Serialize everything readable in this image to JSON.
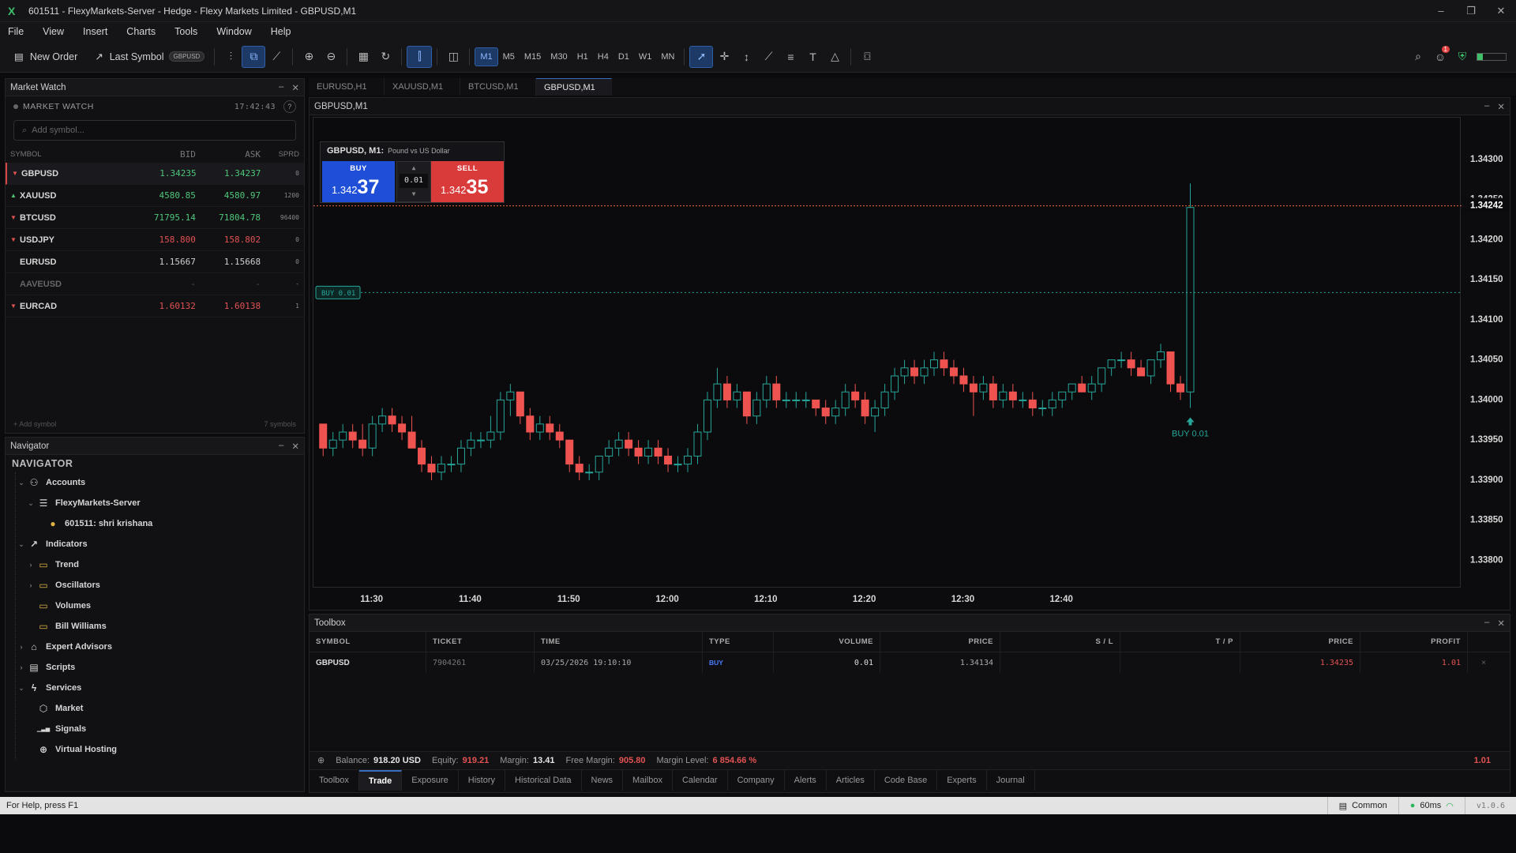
{
  "window": {
    "title": "601511 - FlexyMarkets-Server - Hedge - Flexy Markets Limited - GBPUSD,M1",
    "logo": "X",
    "min": "–",
    "restore": "❐",
    "close": "✕"
  },
  "menu": [
    "File",
    "View",
    "Insert",
    "Charts",
    "Tools",
    "Window",
    "Help"
  ],
  "toolbar": {
    "new_order": "New Order",
    "last_symbol": "Last Symbol",
    "last_symbol_badge": "GBPUSD",
    "timeframes": [
      "M1",
      "M5",
      "M15",
      "M30",
      "H1",
      "H4",
      "D1",
      "W1",
      "MN"
    ],
    "active_tf": "M1",
    "notif_count": "1"
  },
  "market_watch": {
    "title": "Market Watch",
    "subtitle": "MARKET WATCH",
    "time": "17:42:43",
    "help": "?",
    "search_placeholder": "Add symbol...",
    "columns": [
      "SYMBOL",
      "BID",
      "ASK",
      "SPRD"
    ],
    "rows": [
      {
        "symbol": "GBPUSD",
        "dir": "down",
        "bid": "1.34235",
        "ask": "1.34237",
        "spread": "0",
        "color": "up"
      },
      {
        "symbol": "XAUUSD",
        "dir": "up",
        "bid": "4580.85",
        "ask": "4580.97",
        "spread": "1200",
        "color": "up"
      },
      {
        "symbol": "BTCUSD",
        "dir": "down",
        "bid": "71795.14",
        "ask": "71804.78",
        "spread": "96400",
        "color": "up"
      },
      {
        "symbol": "USDJPY",
        "dir": "down",
        "bid": "158.800",
        "ask": "158.802",
        "spread": "0",
        "color": "dn"
      },
      {
        "symbol": "EURUSD",
        "dir": "none",
        "bid": "1.15667",
        "ask": "1.15668",
        "spread": "0",
        "color": "nt"
      },
      {
        "symbol": "AAVEUSD",
        "dir": "none",
        "bid": "-",
        "ask": "-",
        "spread": "-",
        "color": "dim"
      },
      {
        "symbol": "EURCAD",
        "dir": "down",
        "bid": "1.60132",
        "ask": "1.60138",
        "spread": "1",
        "color": "dn"
      }
    ],
    "footer_left": "+ Add symbol",
    "footer_right": "7 symbols"
  },
  "navigator": {
    "title": "Navigator",
    "heading": "NAVIGATOR",
    "items": [
      {
        "label": "Accounts",
        "level": 1,
        "chev": "⌄",
        "icon": "person-icon"
      },
      {
        "label": "FlexyMarkets-Server",
        "level": 2,
        "chev": "⌄",
        "icon": "server-icon"
      },
      {
        "label": "601511: shri krishana",
        "level": 3,
        "chev": "",
        "icon": "user-icon"
      },
      {
        "label": "Indicators",
        "level": 1,
        "chev": "⌄",
        "icon": "indicator-icon"
      },
      {
        "label": "Trend",
        "level": 2,
        "chev": "›",
        "icon": "folder-icon"
      },
      {
        "label": "Oscillators",
        "level": 2,
        "chev": "›",
        "icon": "folder-icon"
      },
      {
        "label": "Volumes",
        "level": 2,
        "chev": "",
        "icon": "folder-icon"
      },
      {
        "label": "Bill Williams",
        "level": 2,
        "chev": "",
        "icon": "folder-icon"
      },
      {
        "label": "Expert Advisors",
        "level": 1,
        "chev": "›",
        "icon": "robot-icon"
      },
      {
        "label": "Scripts",
        "level": 1,
        "chev": "›",
        "icon": "script-icon"
      },
      {
        "label": "Services",
        "level": 1,
        "chev": "⌄",
        "icon": "services-icon"
      },
      {
        "label": "Market",
        "level": 2,
        "chev": "",
        "icon": "cube-icon"
      },
      {
        "label": "Signals",
        "level": 2,
        "chev": "",
        "icon": "signal-icon"
      },
      {
        "label": "Virtual Hosting",
        "level": 2,
        "chev": "",
        "icon": "globe-icon"
      }
    ]
  },
  "chart": {
    "tabs": [
      "EURUSD,H1",
      "XAUUSD,M1",
      "BTCUSD,M1",
      "GBPUSD,M1"
    ],
    "active_tab": 3,
    "window_title": "GBPUSD,M1",
    "trade_symbol": "GBPUSD, M1:",
    "trade_desc": "Pound vs US Dollar",
    "buy_label": "BUY",
    "buy_prefix": "1.342",
    "buy_big": "37",
    "sell_label": "SELL",
    "sell_prefix": "1.342",
    "sell_big": "35",
    "lot": "0.01",
    "lot_up": "▲",
    "lot_down": "▼",
    "order_line_label": "BUY 0.01",
    "arrow_label": "BUY 0.01",
    "current_price": "1.34242"
  },
  "chart_data": {
    "type": "candlestick",
    "symbol": "GBPUSD",
    "timeframe": "M1",
    "y_ticks": [
      1.343,
      1.3425,
      1.342,
      1.3415,
      1.341,
      1.3405,
      1.34,
      1.3395,
      1.339,
      1.3385,
      1.338
    ],
    "y_tick_labels": [
      "1.34300",
      "1.34250",
      "1.34200",
      "1.34150",
      "1.34100",
      "1.34050",
      "1.34000",
      "1.33950",
      "1.33900",
      "1.33850",
      "1.33800"
    ],
    "ylim": [
      1.33765,
      1.34352
    ],
    "x_ticks": [
      "11:30",
      "11:40",
      "11:50",
      "12:00",
      "12:10",
      "12:20",
      "12:30",
      "12:40"
    ],
    "current_price": 1.34242,
    "buy_order_price": 1.34134,
    "candles": [
      [
        1.3397,
        1.3397,
        1.3393,
        1.3394
      ],
      [
        1.3394,
        1.3396,
        1.3393,
        1.3395
      ],
      [
        1.3395,
        1.3397,
        1.3394,
        1.3396
      ],
      [
        1.3396,
        1.3397,
        1.3394,
        1.3395
      ],
      [
        1.3395,
        1.3397,
        1.3393,
        1.3394
      ],
      [
        1.3394,
        1.3398,
        1.3393,
        1.3397
      ],
      [
        1.3397,
        1.3399,
        1.3396,
        1.3398
      ],
      [
        1.3398,
        1.3399,
        1.3396,
        1.3397
      ],
      [
        1.3397,
        1.3398,
        1.3395,
        1.3396
      ],
      [
        1.3396,
        1.3398,
        1.3395,
        1.3394
      ],
      [
        1.3394,
        1.3395,
        1.3391,
        1.3392
      ],
      [
        1.3392,
        1.3393,
        1.339,
        1.3391
      ],
      [
        1.3391,
        1.3393,
        1.339,
        1.3392
      ],
      [
        1.3392,
        1.3393,
        1.3391,
        1.3392
      ],
      [
        1.3392,
        1.3395,
        1.3391,
        1.3394
      ],
      [
        1.3394,
        1.3396,
        1.3393,
        1.3395
      ],
      [
        1.3395,
        1.3396,
        1.3394,
        1.3395
      ],
      [
        1.3395,
        1.3398,
        1.3394,
        1.3396
      ],
      [
        1.3396,
        1.3401,
        1.3395,
        1.34
      ],
      [
        1.34,
        1.3402,
        1.3398,
        1.3401
      ],
      [
        1.3401,
        1.3401,
        1.3397,
        1.3398
      ],
      [
        1.3398,
        1.3399,
        1.3395,
        1.3396
      ],
      [
        1.3396,
        1.3398,
        1.3395,
        1.3397
      ],
      [
        1.3397,
        1.3398,
        1.3395,
        1.3396
      ],
      [
        1.3396,
        1.3397,
        1.3394,
        1.3395
      ],
      [
        1.3395,
        1.3395,
        1.3391,
        1.3392
      ],
      [
        1.3392,
        1.3393,
        1.339,
        1.3391
      ],
      [
        1.3391,
        1.3392,
        1.339,
        1.3391
      ],
      [
        1.3391,
        1.3393,
        1.339,
        1.3393
      ],
      [
        1.3393,
        1.3395,
        1.3392,
        1.3394
      ],
      [
        1.3394,
        1.3396,
        1.3393,
        1.3395
      ],
      [
        1.3395,
        1.3396,
        1.3393,
        1.3394
      ],
      [
        1.3394,
        1.3395,
        1.3392,
        1.3393
      ],
      [
        1.3393,
        1.3395,
        1.3392,
        1.3394
      ],
      [
        1.3394,
        1.3395,
        1.3392,
        1.3393
      ],
      [
        1.3393,
        1.3394,
        1.3391,
        1.3392
      ],
      [
        1.3392,
        1.3393,
        1.3391,
        1.3392
      ],
      [
        1.3392,
        1.3394,
        1.3391,
        1.3393
      ],
      [
        1.3393,
        1.3397,
        1.3392,
        1.3396
      ],
      [
        1.3396,
        1.3401,
        1.3395,
        1.34
      ],
      [
        1.34,
        1.3404,
        1.3399,
        1.3402
      ],
      [
        1.3402,
        1.3403,
        1.3399,
        1.34
      ],
      [
        1.34,
        1.3402,
        1.3399,
        1.3401
      ],
      [
        1.3401,
        1.3401,
        1.3397,
        1.3398
      ],
      [
        1.3398,
        1.3401,
        1.3397,
        1.34
      ],
      [
        1.34,
        1.3403,
        1.3399,
        1.3402
      ],
      [
        1.3402,
        1.3403,
        1.3399,
        1.34
      ],
      [
        1.34,
        1.3401,
        1.3399,
        1.34
      ],
      [
        1.34,
        1.3401,
        1.3399,
        1.34
      ],
      [
        1.34,
        1.3401,
        1.3399,
        1.34
      ],
      [
        1.34,
        1.34,
        1.3398,
        1.3399
      ],
      [
        1.3399,
        1.34,
        1.3397,
        1.3398
      ],
      [
        1.3398,
        1.34,
        1.3397,
        1.3399
      ],
      [
        1.3399,
        1.3402,
        1.3398,
        1.3401
      ],
      [
        1.3401,
        1.3402,
        1.3399,
        1.34
      ],
      [
        1.34,
        1.3401,
        1.3397,
        1.3398
      ],
      [
        1.3398,
        1.34,
        1.3396,
        1.3399
      ],
      [
        1.3399,
        1.3402,
        1.3398,
        1.3401
      ],
      [
        1.3401,
        1.3404,
        1.34,
        1.3403
      ],
      [
        1.3403,
        1.3405,
        1.3402,
        1.3404
      ],
      [
        1.3404,
        1.3405,
        1.3402,
        1.3403
      ],
      [
        1.3403,
        1.3405,
        1.3402,
        1.3404
      ],
      [
        1.3404,
        1.3406,
        1.3403,
        1.3405
      ],
      [
        1.3405,
        1.3406,
        1.3403,
        1.3404
      ],
      [
        1.3404,
        1.3405,
        1.3402,
        1.3403
      ],
      [
        1.3403,
        1.3404,
        1.3401,
        1.3402
      ],
      [
        1.3402,
        1.3403,
        1.3398,
        1.3401
      ],
      [
        1.3401,
        1.3403,
        1.34,
        1.3402
      ],
      [
        1.3402,
        1.3403,
        1.3399,
        1.34
      ],
      [
        1.34,
        1.3402,
        1.3399,
        1.3401
      ],
      [
        1.3401,
        1.3402,
        1.3399,
        1.34
      ],
      [
        1.34,
        1.3401,
        1.3399,
        1.34
      ],
      [
        1.34,
        1.3401,
        1.3398,
        1.3399
      ],
      [
        1.3399,
        1.34,
        1.3398,
        1.3399
      ],
      [
        1.3399,
        1.3401,
        1.3398,
        1.34
      ],
      [
        1.34,
        1.3401,
        1.3399,
        1.3401
      ],
      [
        1.3401,
        1.3402,
        1.34,
        1.3402
      ],
      [
        1.3402,
        1.3403,
        1.3401,
        1.3401
      ],
      [
        1.3401,
        1.3403,
        1.34,
        1.3402
      ],
      [
        1.3402,
        1.3404,
        1.3401,
        1.3404
      ],
      [
        1.3404,
        1.3405,
        1.3403,
        1.3405
      ],
      [
        1.3405,
        1.3406,
        1.3404,
        1.3405
      ],
      [
        1.3405,
        1.3406,
        1.3403,
        1.3404
      ],
      [
        1.3404,
        1.3405,
        1.3403,
        1.3403
      ],
      [
        1.3403,
        1.3405,
        1.3402,
        1.3405
      ],
      [
        1.3405,
        1.3407,
        1.3404,
        1.3406
      ],
      [
        1.3406,
        1.3406,
        1.3401,
        1.3402
      ],
      [
        1.3402,
        1.3403,
        1.34,
        1.3401
      ],
      [
        1.3401,
        1.3427,
        1.3399,
        1.3424
      ]
    ]
  },
  "toolbox": {
    "title": "Toolbox",
    "columns": [
      "SYMBOL",
      "TICKET",
      "TIME",
      "TYPE",
      "VOLUME",
      "PRICE",
      "S / L",
      "T / P",
      "PRICE",
      "PROFIT"
    ],
    "row": {
      "symbol": "GBPUSD",
      "ticket": "7904261",
      "time": "03/25/2026 19:10:10",
      "type": "BUY",
      "volume": "0.01",
      "price": "1.34134",
      "sl": "",
      "tp": "",
      "cur_price": "1.34235",
      "profit": "1.01",
      "close": "×"
    },
    "balance_label": "Balance:",
    "balance": "918.20 USD",
    "equity_label": "Equity:",
    "equity": "919.21",
    "margin_label": "Margin:",
    "margin": "13.41",
    "free_margin_label": "Free Margin:",
    "free_margin": "905.80",
    "margin_level_label": "Margin Level:",
    "margin_level": "6 854.66 %",
    "total_profit": "1.01",
    "tabs": [
      "Toolbox",
      "Trade",
      "Exposure",
      "History",
      "Historical Data",
      "News",
      "Mailbox",
      "Calendar",
      "Company",
      "Alerts",
      "Articles",
      "Code Base",
      "Experts",
      "Journal"
    ],
    "active_tab": 1
  },
  "status": {
    "help": "For Help, press F1",
    "profile": "Common",
    "ping": "60ms",
    "version": "v1.0.6"
  },
  "colors": {
    "bull": "#26a69a",
    "bear": "#ef5350",
    "buy": "#1f4fd6",
    "sell": "#d93a3a"
  }
}
